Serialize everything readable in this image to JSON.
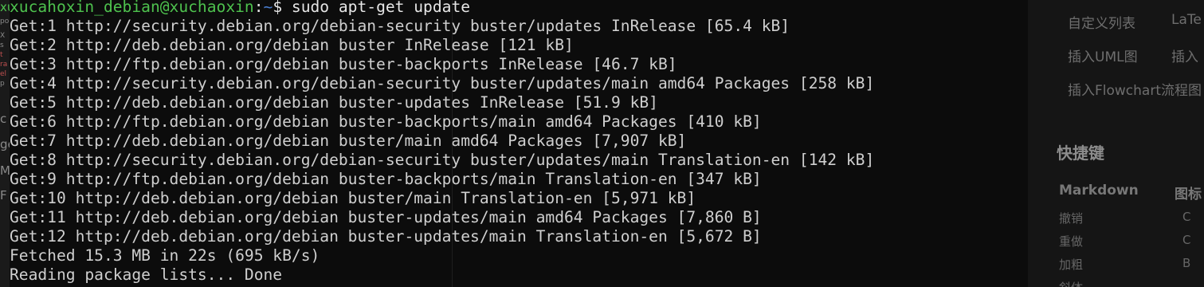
{
  "left_window": {
    "fragments": [
      "xu",
      "po",
      "X",
      "s",
      "t",
      "ra",
      "el",
      "p",
      "c",
      "ge",
      "M",
      "F"
    ]
  },
  "background_editor": {
    "menu_items": [
      "自定义列表",
      "LaTe",
      "插入UML图",
      "插入",
      "插入Flowchart流程图"
    ],
    "section_heading": "快捷键",
    "column_headers": [
      "Markdown",
      "图标"
    ],
    "rows": [
      "撤销",
      "重做",
      "加粗",
      "斜体"
    ],
    "row_keys": [
      "C",
      "C",
      "B",
      ""
    ]
  },
  "terminal": {
    "prompt_user": "xucahoxin_debian@xuchaoxin",
    "prompt_sep": ":",
    "prompt_path": "~",
    "prompt_symbol": "$",
    "command": "sudo apt-get update",
    "output_lines": [
      "Get:1 http://security.debian.org/debian-security buster/updates InRelease [65.4 kB]",
      "Get:2 http://deb.debian.org/debian buster InRelease [121 kB]",
      "Get:3 http://ftp.debian.org/debian buster-backports InRelease [46.7 kB]",
      "Get:4 http://security.debian.org/debian-security buster/updates/main amd64 Packages [258 kB]",
      "Get:5 http://deb.debian.org/debian buster-updates InRelease [51.9 kB]",
      "Get:6 http://ftp.debian.org/debian buster-backports/main amd64 Packages [410 kB]",
      "Get:7 http://deb.debian.org/debian buster/main amd64 Packages [7,907 kB]",
      "Get:8 http://security.debian.org/debian-security buster/updates/main Translation-en [142 kB]",
      "Get:9 http://ftp.debian.org/debian buster-backports/main Translation-en [347 kB]",
      "Get:10 http://deb.debian.org/debian buster/main Translation-en [5,971 kB]",
      "Get:11 http://deb.debian.org/debian buster-updates/main amd64 Packages [7,860 B]",
      "Get:12 http://deb.debian.org/debian buster-updates/main Translation-en [5,672 B]",
      "Fetched 15.3 MB in 22s (695 kB/s)",
      "Reading package lists... Done"
    ],
    "colors": {
      "user": "#4ec24e",
      "path": "#4a7ecf",
      "text": "#cfcfcf",
      "background": "#0c0c0c"
    }
  }
}
